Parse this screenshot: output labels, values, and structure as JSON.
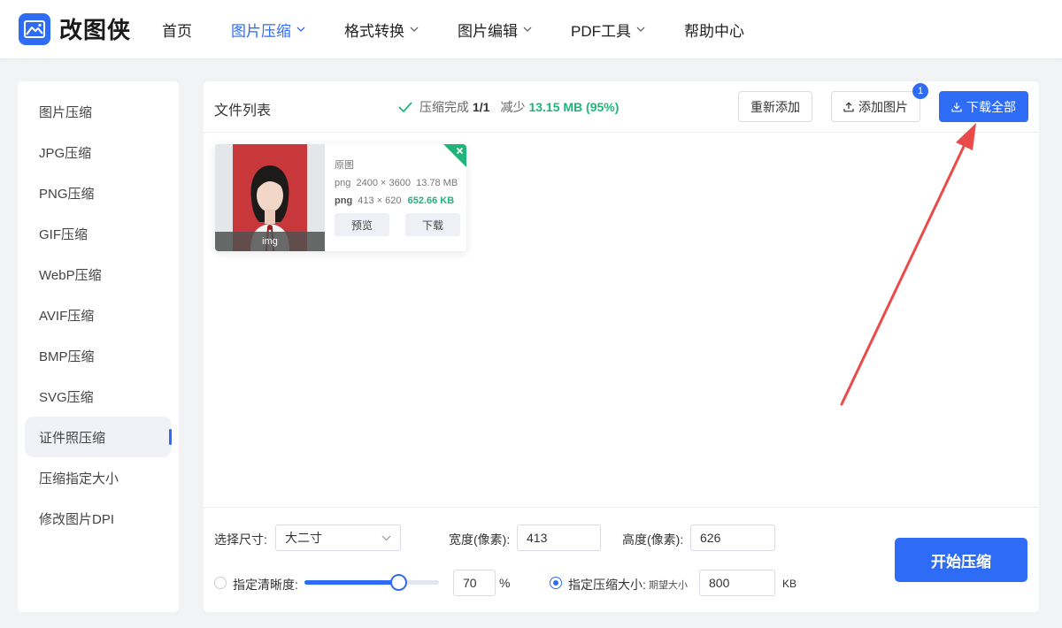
{
  "app": {
    "name": "改图侠",
    "brand_color": "#2f6cf5",
    "success_color": "#1fb57a"
  },
  "nav": {
    "items": [
      {
        "label": "首页",
        "has_dropdown": false,
        "active": false
      },
      {
        "label": "图片压缩",
        "has_dropdown": true,
        "active": true
      },
      {
        "label": "格式转换",
        "has_dropdown": true,
        "active": false
      },
      {
        "label": "图片编辑",
        "has_dropdown": true,
        "active": false
      },
      {
        "label": "PDF工具",
        "has_dropdown": true,
        "active": false
      },
      {
        "label": "帮助中心",
        "has_dropdown": false,
        "active": false
      }
    ]
  },
  "sidebar": {
    "items": [
      {
        "label": "图片压缩"
      },
      {
        "label": "JPG压缩"
      },
      {
        "label": "PNG压缩"
      },
      {
        "label": "GIF压缩"
      },
      {
        "label": "WebP压缩"
      },
      {
        "label": "AVIF压缩"
      },
      {
        "label": "BMP压缩"
      },
      {
        "label": "SVG压缩"
      },
      {
        "label": "证件照压缩",
        "active": true
      },
      {
        "label": "压缩指定大小"
      },
      {
        "label": "修改图片DPI"
      }
    ]
  },
  "file_list": {
    "title": "文件列表",
    "status_label": "压缩完成",
    "status_count": "1/1",
    "saved_label": "减少",
    "saved_value": "13.15 MB (95%)",
    "readd_label": "重新添加",
    "add_label": "添加图片",
    "add_badge": "1",
    "download_all_label": "下载全部"
  },
  "file_card": {
    "thumb_label": "img",
    "original_label": "原图",
    "original_format": "png",
    "original_dims": "2400 × 3600",
    "original_size": "13.78 MB",
    "new_format": "png",
    "new_dims": "413 × 620",
    "new_size": "652.66 KB",
    "preview_label": "预览",
    "download_label": "下载"
  },
  "settings": {
    "size_label": "选择尺寸:",
    "size_value": "大二寸",
    "width_label": "宽度(像素):",
    "width_value": "413",
    "height_label": "高度(像素):",
    "height_value": "626",
    "clarity_label": "指定清晰度:",
    "clarity_selected": false,
    "clarity_value": "70",
    "clarity_fraction": 0.7,
    "clarity_unit": "%",
    "target_label": "指定压缩大小:",
    "target_selected": true,
    "target_hint": "期望大小",
    "target_value": "800",
    "target_unit": "KB",
    "start_label": "开始压缩"
  }
}
